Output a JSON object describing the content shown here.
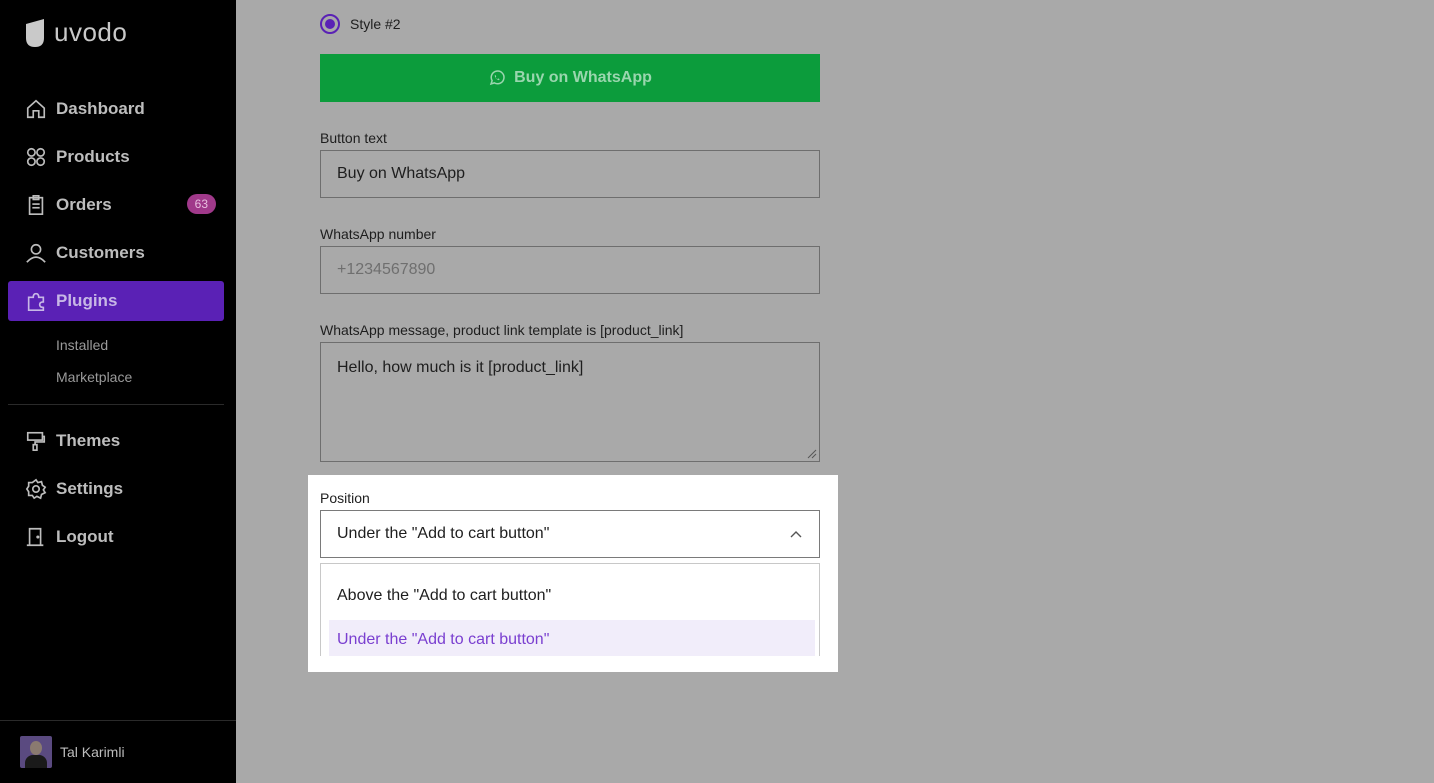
{
  "brand": {
    "name": "uvodo"
  },
  "sidebar": {
    "items": [
      {
        "label": "Dashboard",
        "icon": "home-icon"
      },
      {
        "label": "Products",
        "icon": "grid-icon"
      },
      {
        "label": "Orders",
        "icon": "clipboard-icon",
        "badge": "63"
      },
      {
        "label": "Customers",
        "icon": "user-icon"
      },
      {
        "label": "Plugins",
        "icon": "puzzle-icon",
        "active": true
      }
    ],
    "sub_items": [
      "Installed",
      "Marketplace"
    ],
    "bottom_items": [
      {
        "label": "Themes",
        "icon": "paint-roller-icon"
      },
      {
        "label": "Settings",
        "icon": "gear-icon"
      },
      {
        "label": "Logout",
        "icon": "door-icon"
      }
    ],
    "user": {
      "name": "Tal Karimli"
    }
  },
  "form": {
    "style_option": "Style #2",
    "preview_button": "Buy on WhatsApp",
    "button_text": {
      "label": "Button text",
      "value": "Buy on WhatsApp"
    },
    "number": {
      "label": "WhatsApp number",
      "placeholder": "+1234567890"
    },
    "message": {
      "label": "WhatsApp message, product link template is [product_link]",
      "value": "Hello, how much is it [product_link]"
    },
    "position": {
      "label": "Position",
      "selected": "Under the \"Add to cart button\"",
      "options": [
        "Above the \"Add to cart button\"",
        "Under the \"Add to cart button\""
      ]
    }
  },
  "colors": {
    "accent": "#5a21b5",
    "whatsapp": "#0c9c3c",
    "badge": "#a0398a"
  }
}
